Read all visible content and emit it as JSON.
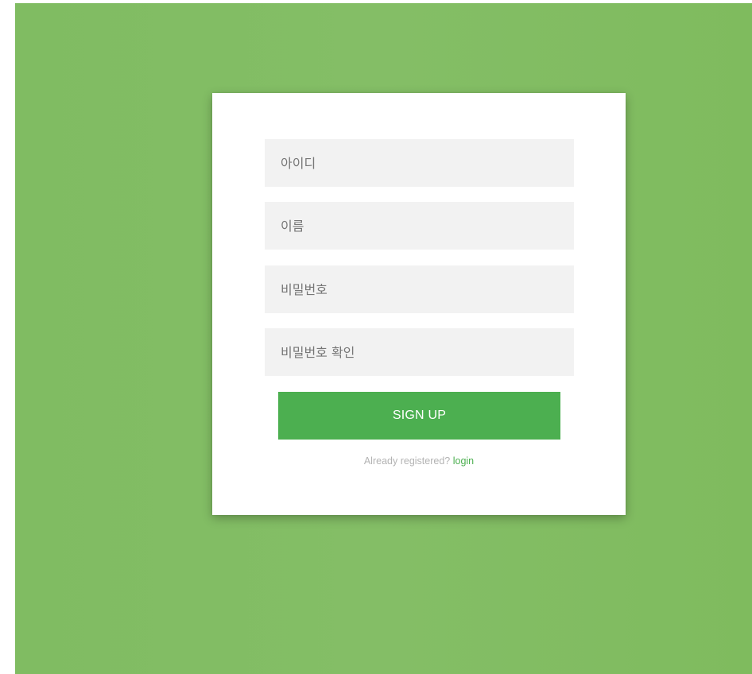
{
  "form": {
    "fields": [
      {
        "placeholder": "아이디",
        "value": ""
      },
      {
        "placeholder": "이름",
        "value": ""
      },
      {
        "placeholder": "비밀번호",
        "value": ""
      },
      {
        "placeholder": "비밀번호 확인",
        "value": ""
      }
    ],
    "submit_label": "SIGN UP",
    "message": {
      "prefix": "Already registered? ",
      "link_label": "login"
    }
  },
  "colors": {
    "background": "#82bd63",
    "accent": "#4caf50",
    "field_bg": "#f2f2f2",
    "card_bg": "#ffffff"
  }
}
